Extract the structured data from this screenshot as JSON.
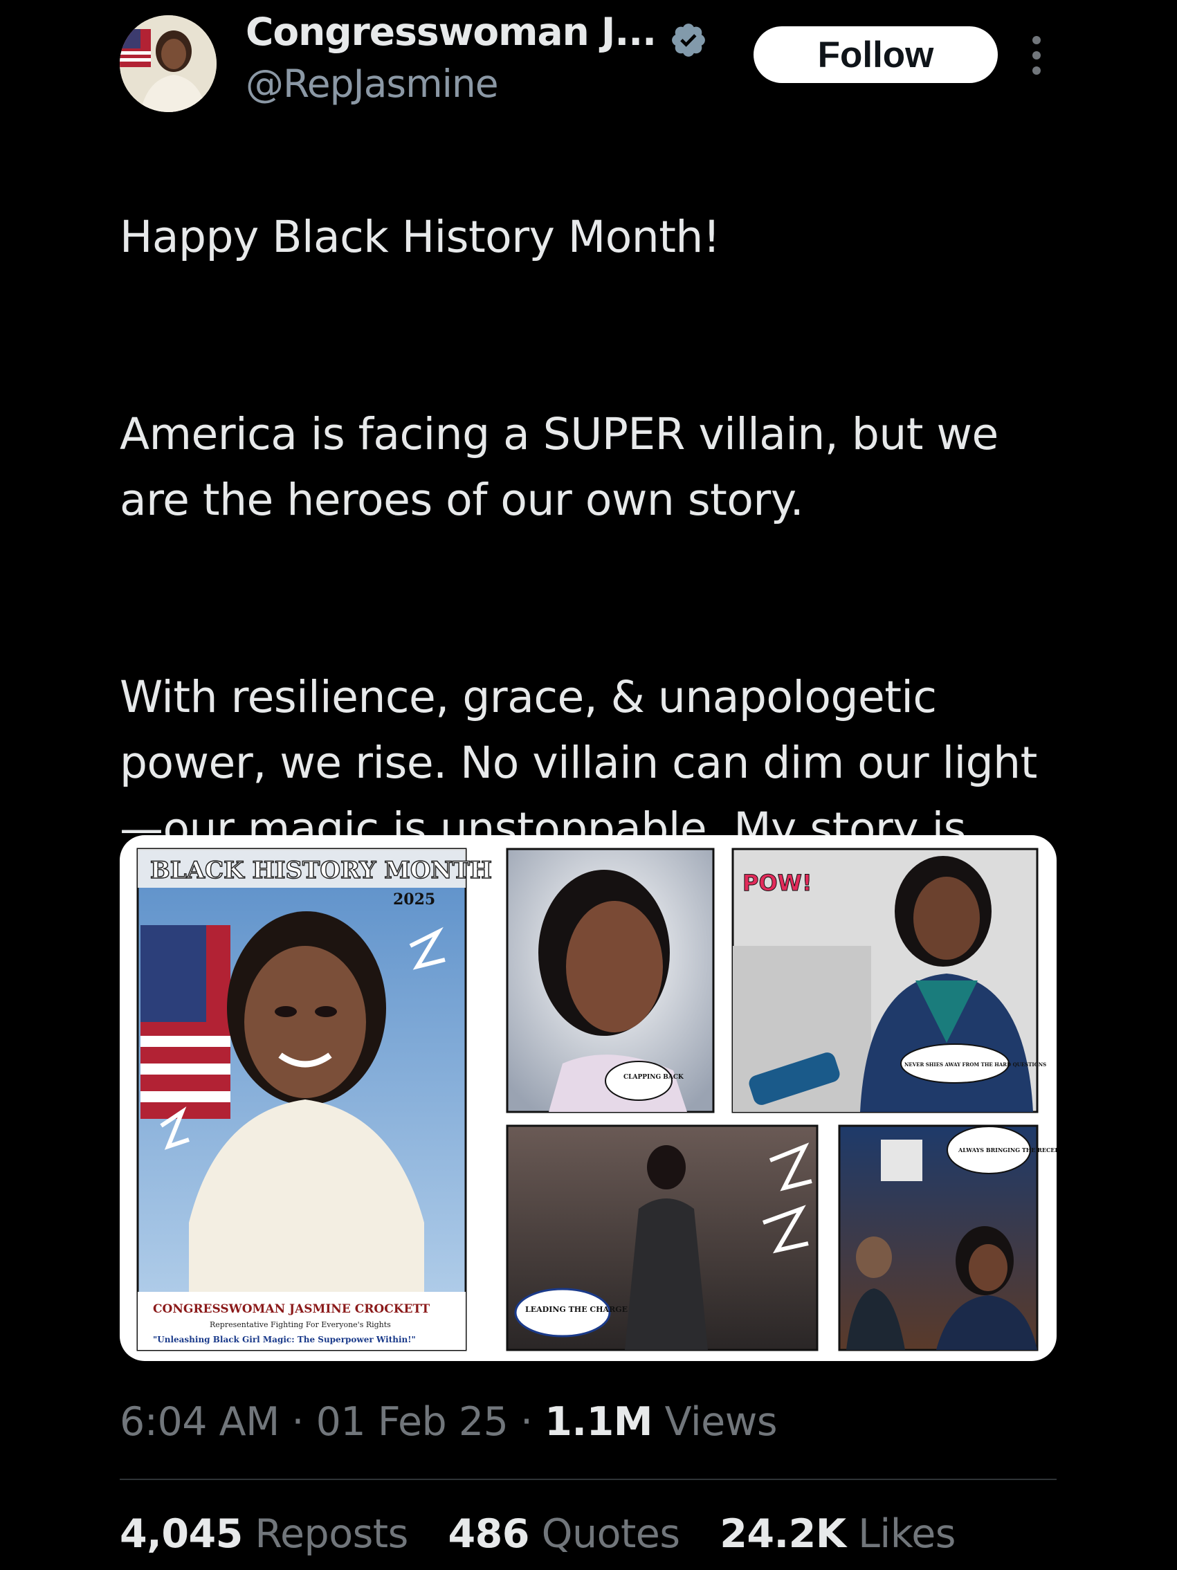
{
  "tweet": {
    "author": {
      "display_name": "Congresswoman J...",
      "handle": "@RepJasmine",
      "verified": true
    },
    "follow_label": "Follow",
    "text": {
      "p1": "Happy Black History Month!",
      "p2": "America is facing a SUPER villain, but we are the heroes of our own story.",
      "p3": "With resilience, grace, & unapologetic power, we rise. No villain can dim our light—our magic is unstoppable. My story is Unleashing Black Girl Magic: The Superpower Within!"
    },
    "media": {
      "cover": {
        "banner": "BLACK HISTORY MONTH",
        "year": "2025",
        "name_line": "CONGRESSWOMAN JASMINE CROCKETT",
        "tagline": "Representative Fighting For Everyone's Rights",
        "title_line": "\"Unleashing Black Girl Magic: The Superpower Within!\""
      },
      "bubbles": {
        "clapping": "CLAPPING BACK",
        "pow": "POW!",
        "never": "NEVER SHIES AWAY FROM THE HARD QUESTIONS",
        "receipts": "ALWAYS BRINGING THE RECEIPTS",
        "leading": "LEADING THE CHARGE"
      }
    },
    "meta": {
      "time": "6:04 AM",
      "date": "01 Feb 25",
      "separator": "·",
      "views_count": "1.1M",
      "views_label": "Views"
    },
    "stats": {
      "reposts_count": "4,045",
      "reposts_label": "Reposts",
      "quotes_count": "486",
      "quotes_label": "Quotes",
      "likes_count": "24.2K",
      "likes_label": "Likes"
    }
  },
  "colors": {
    "background": "#000000",
    "text": "#e7e9ea",
    "muted": "#71767b",
    "handle": "#8b98a5",
    "verified": "#829aab",
    "divider": "#2f3336"
  }
}
